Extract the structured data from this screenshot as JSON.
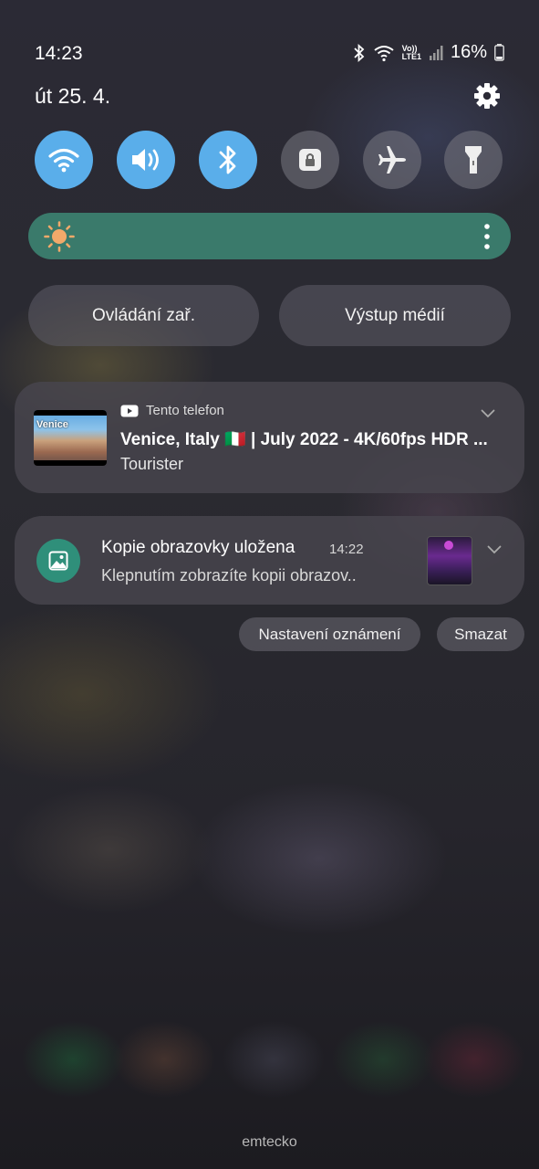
{
  "status_bar": {
    "time": "14:23",
    "volte": "Vo))",
    "lte": "LTE1",
    "battery": "16%",
    "icons": [
      "bluetooth-icon",
      "wifi-icon",
      "signal-icon",
      "battery-icon"
    ]
  },
  "header": {
    "date": "út 25. 4.",
    "settings_icon": "gear-icon"
  },
  "quick_settings": {
    "tiles": [
      {
        "icon": "wifi-icon",
        "active": true
      },
      {
        "icon": "sound-icon",
        "active": true
      },
      {
        "icon": "bluetooth-icon",
        "active": true
      },
      {
        "icon": "rotation-lock-icon",
        "active": false
      },
      {
        "icon": "airplane-icon",
        "active": false
      },
      {
        "icon": "flashlight-icon",
        "active": false
      }
    ],
    "active_color": "#5aaeea"
  },
  "brightness": {
    "level": 1.0,
    "color": "#3a7a6b"
  },
  "buttons": {
    "device_control": "Ovládání zař.",
    "media_output": "Výstup médií"
  },
  "media_notification": {
    "app": "Tento telefon",
    "title": "Venice, Italy 🇮🇹 | July 2022 - 4K/60fps HDR ...",
    "subtitle": "Tourister",
    "thumbnail_label": "Venice"
  },
  "screenshot_notification": {
    "title": "Kopie obrazovky uložena",
    "time": "14:22",
    "text": "Klepnutím zobrazíte kopii obrazov..",
    "accent": "#2f8f7a"
  },
  "actions": {
    "settings": "Nastavení oznámení",
    "clear": "Smazat"
  },
  "watermark": "emtecko"
}
